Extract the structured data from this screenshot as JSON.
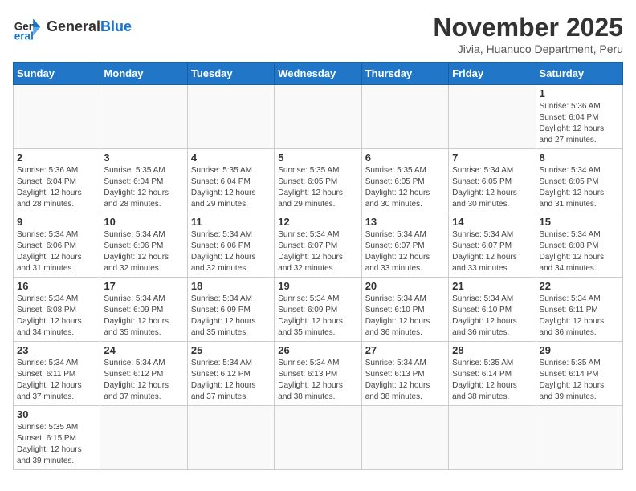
{
  "header": {
    "logo_general": "General",
    "logo_blue": "Blue",
    "month_title": "November 2025",
    "subtitle": "Jivia, Huanuco Department, Peru"
  },
  "days_of_week": [
    "Sunday",
    "Monday",
    "Tuesday",
    "Wednesday",
    "Thursday",
    "Friday",
    "Saturday"
  ],
  "weeks": [
    [
      {
        "day": "",
        "info": ""
      },
      {
        "day": "",
        "info": ""
      },
      {
        "day": "",
        "info": ""
      },
      {
        "day": "",
        "info": ""
      },
      {
        "day": "",
        "info": ""
      },
      {
        "day": "",
        "info": ""
      },
      {
        "day": "1",
        "info": "Sunrise: 5:36 AM\nSunset: 6:04 PM\nDaylight: 12 hours and 27 minutes."
      }
    ],
    [
      {
        "day": "2",
        "info": "Sunrise: 5:36 AM\nSunset: 6:04 PM\nDaylight: 12 hours and 28 minutes."
      },
      {
        "day": "3",
        "info": "Sunrise: 5:35 AM\nSunset: 6:04 PM\nDaylight: 12 hours and 28 minutes."
      },
      {
        "day": "4",
        "info": "Sunrise: 5:35 AM\nSunset: 6:04 PM\nDaylight: 12 hours and 29 minutes."
      },
      {
        "day": "5",
        "info": "Sunrise: 5:35 AM\nSunset: 6:05 PM\nDaylight: 12 hours and 29 minutes."
      },
      {
        "day": "6",
        "info": "Sunrise: 5:35 AM\nSunset: 6:05 PM\nDaylight: 12 hours and 30 minutes."
      },
      {
        "day": "7",
        "info": "Sunrise: 5:34 AM\nSunset: 6:05 PM\nDaylight: 12 hours and 30 minutes."
      },
      {
        "day": "8",
        "info": "Sunrise: 5:34 AM\nSunset: 6:05 PM\nDaylight: 12 hours and 31 minutes."
      }
    ],
    [
      {
        "day": "9",
        "info": "Sunrise: 5:34 AM\nSunset: 6:06 PM\nDaylight: 12 hours and 31 minutes."
      },
      {
        "day": "10",
        "info": "Sunrise: 5:34 AM\nSunset: 6:06 PM\nDaylight: 12 hours and 32 minutes."
      },
      {
        "day": "11",
        "info": "Sunrise: 5:34 AM\nSunset: 6:06 PM\nDaylight: 12 hours and 32 minutes."
      },
      {
        "day": "12",
        "info": "Sunrise: 5:34 AM\nSunset: 6:07 PM\nDaylight: 12 hours and 32 minutes."
      },
      {
        "day": "13",
        "info": "Sunrise: 5:34 AM\nSunset: 6:07 PM\nDaylight: 12 hours and 33 minutes."
      },
      {
        "day": "14",
        "info": "Sunrise: 5:34 AM\nSunset: 6:07 PM\nDaylight: 12 hours and 33 minutes."
      },
      {
        "day": "15",
        "info": "Sunrise: 5:34 AM\nSunset: 6:08 PM\nDaylight: 12 hours and 34 minutes."
      }
    ],
    [
      {
        "day": "16",
        "info": "Sunrise: 5:34 AM\nSunset: 6:08 PM\nDaylight: 12 hours and 34 minutes."
      },
      {
        "day": "17",
        "info": "Sunrise: 5:34 AM\nSunset: 6:09 PM\nDaylight: 12 hours and 35 minutes."
      },
      {
        "day": "18",
        "info": "Sunrise: 5:34 AM\nSunset: 6:09 PM\nDaylight: 12 hours and 35 minutes."
      },
      {
        "day": "19",
        "info": "Sunrise: 5:34 AM\nSunset: 6:09 PM\nDaylight: 12 hours and 35 minutes."
      },
      {
        "day": "20",
        "info": "Sunrise: 5:34 AM\nSunset: 6:10 PM\nDaylight: 12 hours and 36 minutes."
      },
      {
        "day": "21",
        "info": "Sunrise: 5:34 AM\nSunset: 6:10 PM\nDaylight: 12 hours and 36 minutes."
      },
      {
        "day": "22",
        "info": "Sunrise: 5:34 AM\nSunset: 6:11 PM\nDaylight: 12 hours and 36 minutes."
      }
    ],
    [
      {
        "day": "23",
        "info": "Sunrise: 5:34 AM\nSunset: 6:11 PM\nDaylight: 12 hours and 37 minutes."
      },
      {
        "day": "24",
        "info": "Sunrise: 5:34 AM\nSunset: 6:12 PM\nDaylight: 12 hours and 37 minutes."
      },
      {
        "day": "25",
        "info": "Sunrise: 5:34 AM\nSunset: 6:12 PM\nDaylight: 12 hours and 37 minutes."
      },
      {
        "day": "26",
        "info": "Sunrise: 5:34 AM\nSunset: 6:13 PM\nDaylight: 12 hours and 38 minutes."
      },
      {
        "day": "27",
        "info": "Sunrise: 5:34 AM\nSunset: 6:13 PM\nDaylight: 12 hours and 38 minutes."
      },
      {
        "day": "28",
        "info": "Sunrise: 5:35 AM\nSunset: 6:14 PM\nDaylight: 12 hours and 38 minutes."
      },
      {
        "day": "29",
        "info": "Sunrise: 5:35 AM\nSunset: 6:14 PM\nDaylight: 12 hours and 39 minutes."
      }
    ],
    [
      {
        "day": "30",
        "info": "Sunrise: 5:35 AM\nSunset: 6:15 PM\nDaylight: 12 hours and 39 minutes."
      },
      {
        "day": "",
        "info": ""
      },
      {
        "day": "",
        "info": ""
      },
      {
        "day": "",
        "info": ""
      },
      {
        "day": "",
        "info": ""
      },
      {
        "day": "",
        "info": ""
      },
      {
        "day": "",
        "info": ""
      }
    ]
  ]
}
